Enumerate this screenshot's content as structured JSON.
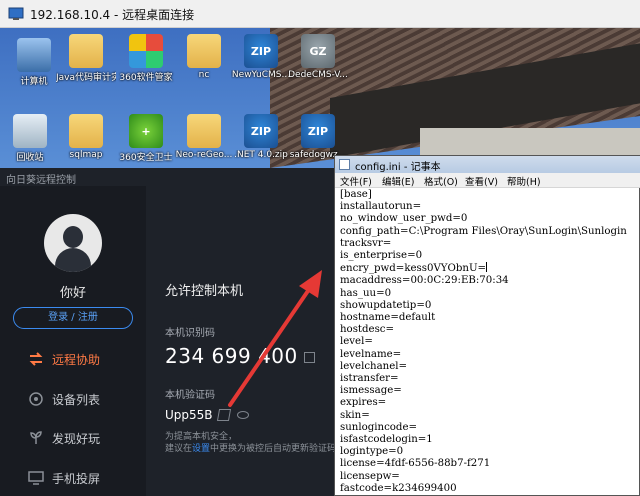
{
  "rdp": {
    "title": "192.168.10.4 - 远程桌面连接"
  },
  "desktop": {
    "icons": [
      {
        "label": "计算机",
        "icon": "computer-icon"
      },
      {
        "label": "Java代码审计实战",
        "icon": "folder-icon"
      },
      {
        "label": "360软件管家",
        "icon": "flower-icon"
      },
      {
        "label": "nc",
        "icon": "folder-icon"
      },
      {
        "label": "NewYuCMS...",
        "icon": "zip-icon"
      },
      {
        "label": "DedeCMS-V...",
        "icon": "gz-icon"
      },
      {
        "label": "回收站",
        "icon": "recycle-bin-icon"
      },
      {
        "label": "sqlmap",
        "icon": "folder-icon"
      },
      {
        "label": "360安全卫士",
        "icon": "shield-plus-icon"
      },
      {
        "label": "Neo-reGeo...",
        "icon": "folder-icon"
      },
      {
        "label": ".NET 4.0.zip",
        "icon": "zip-icon"
      },
      {
        "label": "safedogwz...",
        "icon": "zip-icon"
      }
    ]
  },
  "app": {
    "window_title": "向日葵远程控制",
    "greeting": "你好",
    "login_label": "登录 / 注册",
    "nav": [
      {
        "label": "远程协助",
        "active": true
      },
      {
        "label": "设备列表",
        "active": false
      },
      {
        "label": "发现好玩",
        "active": false
      },
      {
        "label": "手机投屏",
        "active": false
      }
    ],
    "allow_title": "允许控制本机",
    "id_label": "本机识别码",
    "id_value": "234 699 400",
    "code_label": "本机验证码",
    "code_value": "Upp55B",
    "note_line1": "为提高本机安全，",
    "note_line2_pre": "建议在",
    "note_line2_link": "设置",
    "note_line2_post": "中更换为被控后自动更新验证码"
  },
  "accent_color": "#ff7a45",
  "arrow_color": "#e53935",
  "notepad": {
    "title": "config.ini - 记事本",
    "menu": [
      "文件(F)",
      "编辑(E)",
      "格式(O)",
      "查看(V)",
      "帮助(H)"
    ],
    "lines": [
      "[base]",
      "installautorun=",
      "no_window_user_pwd=0",
      "config_path=C:\\Program Files\\Oray\\SunLogin\\Sunlogin",
      "tracksvr=",
      "is_enterprise=0",
      "encry_pwd=kess0VYObnU=",
      "macaddress=00:0C:29:EB:70:34",
      "has_uu=0",
      "showupdatetip=0",
      "hostname=default",
      "hostdesc=",
      "level=",
      "levelname=",
      "levelchanel=",
      "istransfer=",
      "ismessage=",
      "expires=",
      "skin=",
      "sunlogincode=",
      "isfastcodelogin=1",
      "logintype=0",
      "license=4fdf-6556-88b7-f271",
      "licensepw=",
      "fastcode=k234699400"
    ]
  }
}
